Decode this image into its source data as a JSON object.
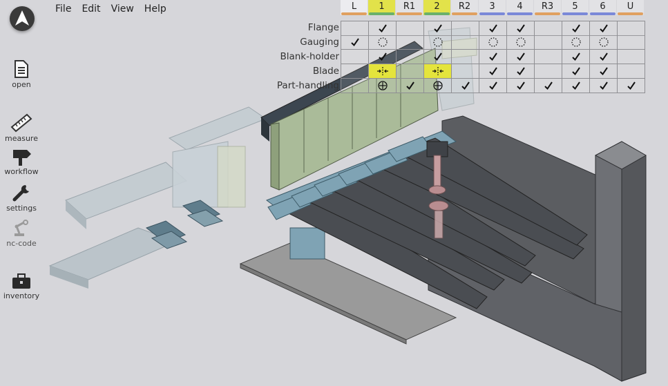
{
  "menu": [
    "File",
    "Edit",
    "View",
    "Help"
  ],
  "toolbar": {
    "open": "open",
    "measure": "measure",
    "workflow": "workflow",
    "settings": "settings",
    "nc_code": "nc-code",
    "inventory": "inventory"
  },
  "colors": {
    "group_orange": "#e0a060",
    "group_green": "#6ab06a",
    "group_blue": "#7a88d8",
    "highlight_yellow": "#e4e43c"
  },
  "columns": [
    {
      "label": "L",
      "group": "orange",
      "selected": "light"
    },
    {
      "label": "1",
      "group": "green",
      "selected": "yellow"
    },
    {
      "label": "R1",
      "group": "orange",
      "selected": ""
    },
    {
      "label": "2",
      "group": "green",
      "selected": "yellow"
    },
    {
      "label": "R2",
      "group": "orange",
      "selected": ""
    },
    {
      "label": "3",
      "group": "blue",
      "selected": ""
    },
    {
      "label": "4",
      "group": "blue",
      "selected": ""
    },
    {
      "label": "R3",
      "group": "orange",
      "selected": ""
    },
    {
      "label": "5",
      "group": "blue",
      "selected": ""
    },
    {
      "label": "6",
      "group": "blue",
      "selected": ""
    },
    {
      "label": "U",
      "group": "orange",
      "selected": ""
    }
  ],
  "rows": [
    {
      "label": "Flange",
      "cells": [
        "",
        "check",
        "",
        "check",
        "",
        "check",
        "check",
        "",
        "check",
        "check",
        ""
      ]
    },
    {
      "label": "Gauging",
      "cells": [
        "check",
        "dotted",
        "",
        "dotted",
        "",
        "dotted",
        "dotted",
        "",
        "dotted",
        "dotted",
        ""
      ]
    },
    {
      "label": "Blank-holder",
      "cells": [
        "",
        "check",
        "",
        "check",
        "",
        "check",
        "check",
        "",
        "check",
        "check",
        ""
      ]
    },
    {
      "label": "Blade",
      "cells": [
        "",
        "blade",
        "",
        "blade",
        "",
        "check",
        "check",
        "",
        "check",
        "check",
        ""
      ]
    },
    {
      "label": "Part-handling",
      "cells": [
        "",
        "target",
        "check",
        "target",
        "check",
        "check",
        "check",
        "check",
        "check",
        "check",
        "check"
      ]
    }
  ]
}
